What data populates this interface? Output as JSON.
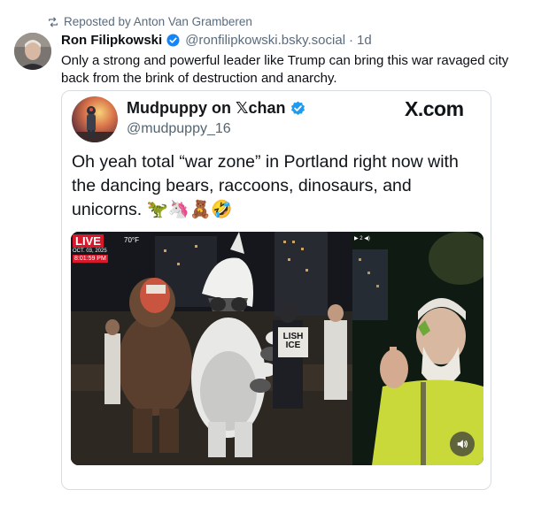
{
  "repost": {
    "icon": "repost-icon",
    "text": "Reposted by Anton Van Gramberen"
  },
  "post": {
    "author_name": "Ron Filipkowski",
    "handle": "@ronfilipkowski.bsky.social",
    "separator": "·",
    "age": "1d",
    "text": "Only a strong and powerful leader like Trump can bring this war ravaged city back from the brink of destruction and anarchy."
  },
  "embed": {
    "author_name": "Mudpuppy on 𝕏chan",
    "handle": "@mudpuppy_16",
    "source_label": "X.com",
    "text": "Oh yeah total “war zone” in Portland right now with the dancing bears, raccoons, dinosaurs, and unicorns. 🦖🦄🧸🤣",
    "video": {
      "live_badge": "LIVE",
      "temperature": "70°F",
      "date": "OCT. 03, 2025",
      "time": "8:01:59 PM",
      "indicator": "▶ 2 ◀)",
      "sign_text": "LISH\nICE"
    }
  },
  "colors": {
    "accent_blue": "#1185fe",
    "live_red": "#d7182a",
    "muted_text": "#5a6b7d"
  }
}
